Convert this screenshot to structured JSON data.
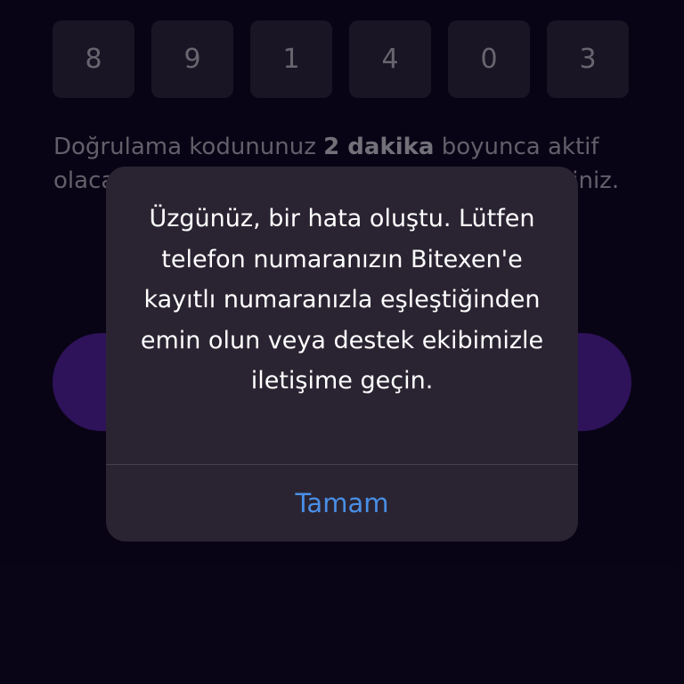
{
  "verification": {
    "code_digits": [
      "8",
      "9",
      "1",
      "4",
      "0",
      "3"
    ],
    "info_prefix": "Doğrulama kodununuz ",
    "info_bold": "2 dakika",
    "info_suffix": " boyunca aktif olacaktır. Kodu tekrar göndermek için bekleyiniz."
  },
  "alert": {
    "message": "Üzgünüz, bir hata oluştu. Lütfen telefon numaranızın Bitexen'e kayıtlı numaranızla eşleştiğinden emin olun veya destek ekibimizle iletişime geçin.",
    "button_label": "Tamam",
    "button_color": "#4a8fe6"
  },
  "colors": {
    "background": "#0f0823",
    "code_box": "#29223a",
    "primary_button": "#4b1e92",
    "alert_bg": "#2a2432"
  }
}
